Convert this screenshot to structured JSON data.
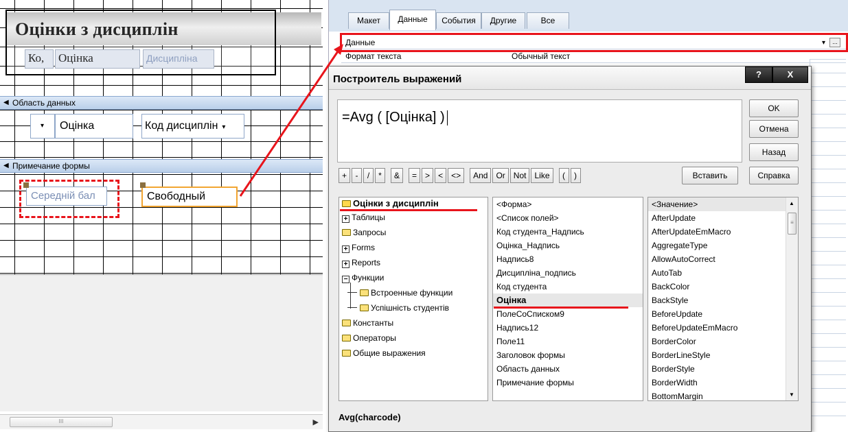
{
  "designer": {
    "header_title": "Оцінки з дисциплін",
    "header_labels": [
      "Ко,",
      "Оцінка",
      "Дисципліна"
    ],
    "section_detail": "Область данных",
    "section_footer": "Примечание формы",
    "detail_controls": {
      "combo_arrow": "▾",
      "mark_label": "Оцінка",
      "discipline_combo": "Код дисциплін"
    },
    "footer_controls": {
      "avg_label": "Середній бал",
      "free_field": "Свободный"
    },
    "scroll_thumb": "III"
  },
  "property_sheet": {
    "tabs": [
      "Макет",
      "Данные",
      "События",
      "Другие",
      "Все"
    ],
    "active_tab": "Данные",
    "rows": [
      {
        "key": "Данные",
        "value": ""
      },
      {
        "key": "Формат текста",
        "value": "Обычный текст"
      }
    ],
    "builder_button": "..."
  },
  "dialog": {
    "title": "Построитель выражений",
    "help_btn": "?",
    "close_btn": "X",
    "expression": "=Avg ( [Оцінка] )",
    "buttons": {
      "ok": "OK",
      "cancel": "Отмена",
      "back": "Назад",
      "paste": "Вставить",
      "help": "Справка"
    },
    "operators": [
      "+",
      "-",
      "/",
      "*",
      "&",
      "=",
      ">",
      "<",
      "<>",
      "And",
      "Or",
      "Not",
      "Like",
      "(",
      ")"
    ],
    "tree": [
      {
        "label": "Оцінки з дисциплін",
        "icon": "folder-open-icon",
        "selected": true
      },
      {
        "label": "Таблицы",
        "icon": "plus-icon"
      },
      {
        "label": "Запросы",
        "icon": "folder-icon"
      },
      {
        "label": "Forms",
        "icon": "plus-icon"
      },
      {
        "label": "Reports",
        "icon": "plus-icon"
      },
      {
        "label": "Функции",
        "icon": "minus-icon"
      },
      {
        "label": "Встроенные функции",
        "icon": "folder-icon",
        "child": true
      },
      {
        "label": "Успішність студентів",
        "icon": "folder-icon",
        "child": true
      },
      {
        "label": "Константы",
        "icon": "folder-icon"
      },
      {
        "label": "Операторы",
        "icon": "folder-icon"
      },
      {
        "label": "Общие выражения",
        "icon": "folder-icon"
      }
    ],
    "fields": [
      "<Форма>",
      "<Список полей>",
      "Код студента_Надпись",
      "Оцінка_Надпись",
      "Надпись8",
      "Дисципліна_подпись",
      "Код студента",
      "Оцінка",
      "ПолеСоСписком9",
      "Надпись12",
      "Поле11",
      "Заголовок формы",
      "Область данных",
      "Примечание формы"
    ],
    "selected_field": "Оцінка",
    "values": [
      "<Значение>",
      "AfterUpdate",
      "AfterUpdateEmMacro",
      "AggregateType",
      "AllowAutoCorrect",
      "AutoTab",
      "BackColor",
      "BackStyle",
      "BeforeUpdate",
      "BeforeUpdateEmMacro",
      "BorderColor",
      "BorderLineStyle",
      "BorderStyle",
      "BorderWidth",
      "BottomMargin"
    ],
    "status": "Avg(charcode)"
  },
  "colors": {
    "highlight_red": "#e8141b",
    "section_blue": "#c6d7ee",
    "selection_orange": "#f2a531"
  }
}
